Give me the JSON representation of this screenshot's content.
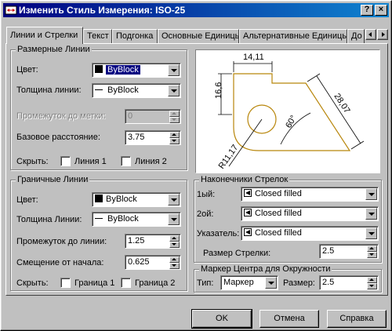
{
  "window": {
    "title": "Изменить Стиль Измерения: ISO-25",
    "help_btn": "?",
    "close_btn": "×"
  },
  "tabs": [
    {
      "label": "Линии и Стрелки"
    },
    {
      "label": "Текст"
    },
    {
      "label": "Подгонка"
    },
    {
      "label": "Основные Единицы"
    },
    {
      "label": "Альтернативные Единицы"
    },
    {
      "label": "До"
    }
  ],
  "dim_lines": {
    "title": "Размерные Линии",
    "color_label": "Цвет:",
    "color_value": "ByBlock",
    "lineweight_label": "Толщина линии:",
    "lineweight_value": "ByBlock",
    "extend_label": "Промежуток до метки:",
    "extend_value": "0",
    "baseline_label": "Базовое расстояние:",
    "baseline_value": "3.75",
    "suppress_label": "Скрыть:",
    "line1_label": "Линия 1",
    "line2_label": "Линия 2"
  },
  "ext_lines": {
    "title": "Граничные Линии",
    "color_label": "Цвет:",
    "color_value": "ByBlock",
    "lineweight_label": "Толщина Линии:",
    "lineweight_value": "ByBlock",
    "extend_label": "Промежуток до линии:",
    "extend_value": "1.25",
    "offset_label": "Смещение от начала:",
    "offset_value": "0.625",
    "suppress_label": "Скрыть:",
    "ext1_label": "Граница 1",
    "ext2_label": "Граница 2"
  },
  "preview": {
    "dim_top": "14,11",
    "dim_left": "16,6",
    "dim_right": "28,07",
    "dim_angle": "60°",
    "dim_radius": "R11,17"
  },
  "arrowheads": {
    "title": "Наконечники Стрелок",
    "first_label": "1ый:",
    "first_value": "Closed filled",
    "second_label": "2ой:",
    "second_value": "Closed filled",
    "leader_label": "Указатель:",
    "leader_value": "Closed filled",
    "size_label": "Размер Стрелки:",
    "size_value": "2.5"
  },
  "center_marks": {
    "title": "Маркер Центра для Окружности",
    "type_label": "Тип:",
    "type_value": "Маркер",
    "size_label": "Размер:",
    "size_value": "2.5"
  },
  "buttons": {
    "ok": "OK",
    "cancel": "Отмена",
    "help": "Справка"
  }
}
